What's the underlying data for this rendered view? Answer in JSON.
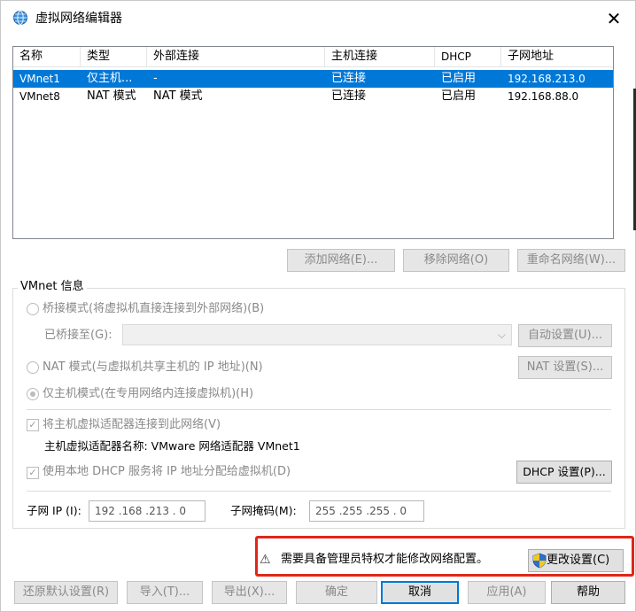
{
  "window": {
    "title": "虚拟网络编辑器",
    "close_label": "✕"
  },
  "table": {
    "headers": [
      "名称",
      "类型",
      "外部连接",
      "主机连接",
      "DHCP",
      "子网地址"
    ],
    "rows": [
      [
        "VMnet1",
        "仅主机...",
        "-",
        "已连接",
        "已启用",
        "192.168.213.0"
      ],
      [
        "VMnet8",
        "NAT 模式",
        "NAT 模式",
        "已连接",
        "已启用",
        "192.168.88.0"
      ]
    ]
  },
  "net_buttons": {
    "add": "添加网络(E)...",
    "remove": "移除网络(O)",
    "rename": "重命名网络(W)..."
  },
  "vmnet_info": {
    "group_label": "VMnet 信息",
    "bridge_mode": "桥接模式(将虚拟机直接连接到外部网络)(B)",
    "bridged_to": "已桥接至(G):",
    "auto_settings": "自动设置(U)...",
    "nat_mode": "NAT 模式(与虚拟机共享主机的 IP 地址)(N)",
    "nat_settings": "NAT 设置(S)...",
    "host_only_mode": "仅主机模式(在专用网络内连接虚拟机)(H)",
    "connect_adapter": "将主机虚拟适配器连接到此网络(V)",
    "adapter_name": "主机虚拟适配器名称: VMware 网络适配器 VMnet1",
    "use_dhcp": "使用本地 DHCP 服务将 IP 地址分配给虚拟机(D)",
    "dhcp_settings": "DHCP 设置(P)...",
    "subnet_ip_label": "子网 IP (I):",
    "subnet_ip_value": "192 .168 .213 .  0",
    "subnet_mask_label": "子网掩码(M):",
    "subnet_mask_value": "255 .255 .255 .  0"
  },
  "admin": {
    "message": "需要具备管理员特权才能修改网络配置。",
    "change_settings": "更改设置(C)",
    "warning_glyph": "⚠"
  },
  "footer": {
    "restore": "还原默认设置(R)",
    "import": "导入(T)...",
    "export": "导出(X)...",
    "ok": "确定",
    "cancel": "取消",
    "apply": "应用(A)",
    "help": "帮助"
  },
  "colors": {
    "selection": "#0078d7",
    "highlight_border": "#e0261a"
  }
}
